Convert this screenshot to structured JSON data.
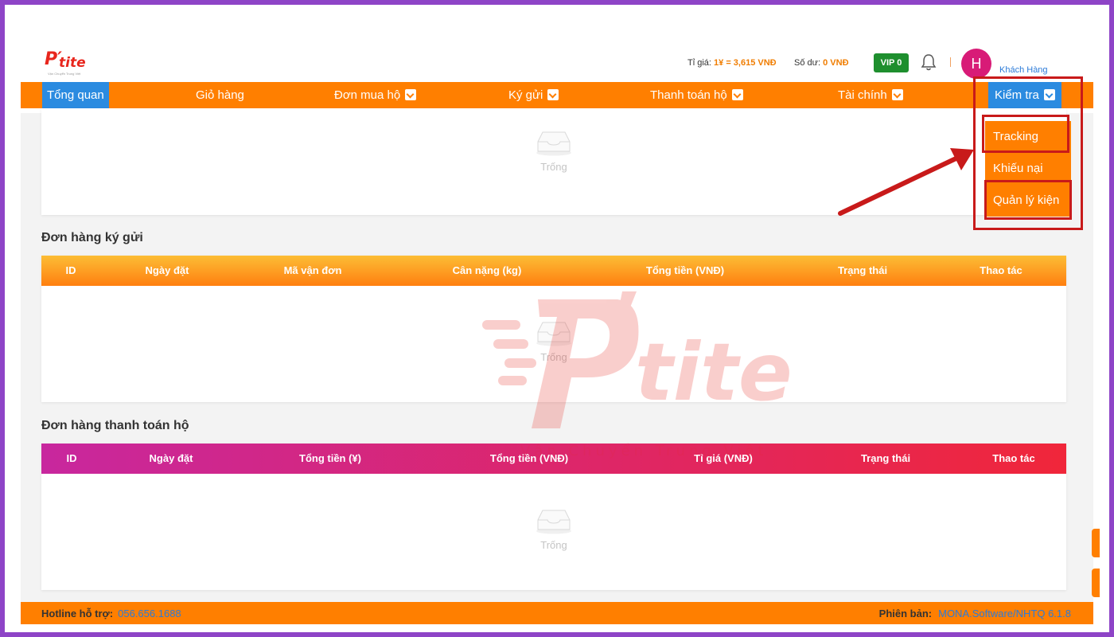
{
  "header": {
    "logo_word": "tite",
    "logo_tagline": "Vận Chuyển Trung Việt",
    "rate_label": "Tỉ giá:",
    "rate_value": "1¥ = 3,615 VNĐ",
    "balance_label": "Số dư:",
    "balance_value": "0 VNĐ",
    "vip_label": "VIP 0",
    "avatar_initial": "H",
    "user_name": "Khách Hàng"
  },
  "nav": {
    "items": [
      {
        "label": "Tổng quan"
      },
      {
        "label": "Giỏ hàng"
      },
      {
        "label": "Đơn mua hộ"
      },
      {
        "label": "Ký gửi"
      },
      {
        "label": "Thanh toán hộ"
      },
      {
        "label": "Tài chính"
      },
      {
        "label": "Kiểm tra"
      }
    ]
  },
  "dropdown": {
    "items": [
      {
        "label": "Tracking"
      },
      {
        "label": "Khiếu nại"
      },
      {
        "label": "Quản lý kiện"
      }
    ]
  },
  "empty_text": "Trống",
  "consignment": {
    "title": "Đơn hàng ký gửi",
    "columns": [
      "ID",
      "Ngày đặt",
      "Mã vận đơn",
      "Cân nặng (kg)",
      "Tổng tiền (VNĐ)",
      "Trạng thái",
      "Thao tác"
    ],
    "rows": []
  },
  "payment": {
    "title": "Đơn hàng thanh toán hộ",
    "columns": [
      "ID",
      "Ngày đặt",
      "Tổng tiền (¥)",
      "Tổng tiền (VNĐ)",
      "Tỉ giá (VNĐ)",
      "Trạng thái",
      "Thao tác"
    ],
    "rows": []
  },
  "watermark": {
    "word": "tite",
    "tagline": "Vận Chuyển Trung Việt"
  },
  "footer": {
    "hotline_label": "Hotline hỗ trợ:",
    "hotline_value": "056.656.1688",
    "version_label": "Phiên bản:",
    "version_value": "MONA.Software/NHTQ 6.1.8"
  },
  "colors": {
    "brand_orange": "#ff7f00",
    "active_blue": "#2b8be0",
    "highlight_red": "#c81a1a",
    "frame_purple": "#8e44c7"
  }
}
